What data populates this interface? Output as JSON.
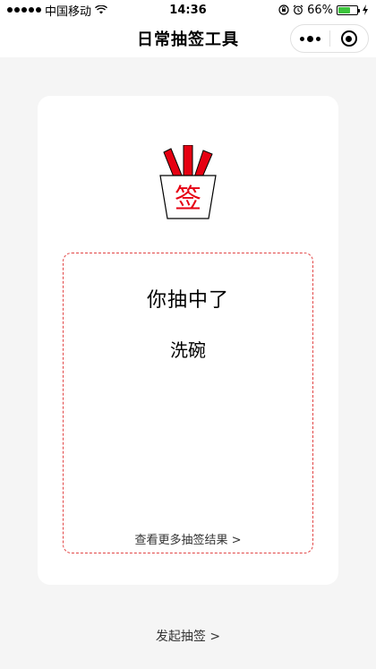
{
  "status_bar": {
    "carrier": "中国移动",
    "time": "14:36",
    "battery": "66%",
    "battery_level": 0.66,
    "battery_color": "#3cc43c"
  },
  "nav": {
    "title": "日常抽签工具",
    "more_icon": "more-dots-icon",
    "close_icon": "target-circle-icon"
  },
  "card": {
    "icon": "lottery-cup-icon",
    "icon_text": "签",
    "accent_color": "#e24545",
    "result_heading": "你抽中了",
    "result_value": "洗碗",
    "more_results_link": "查看更多抽签结果 >"
  },
  "footer": {
    "start_link": "发起抽签 >"
  }
}
